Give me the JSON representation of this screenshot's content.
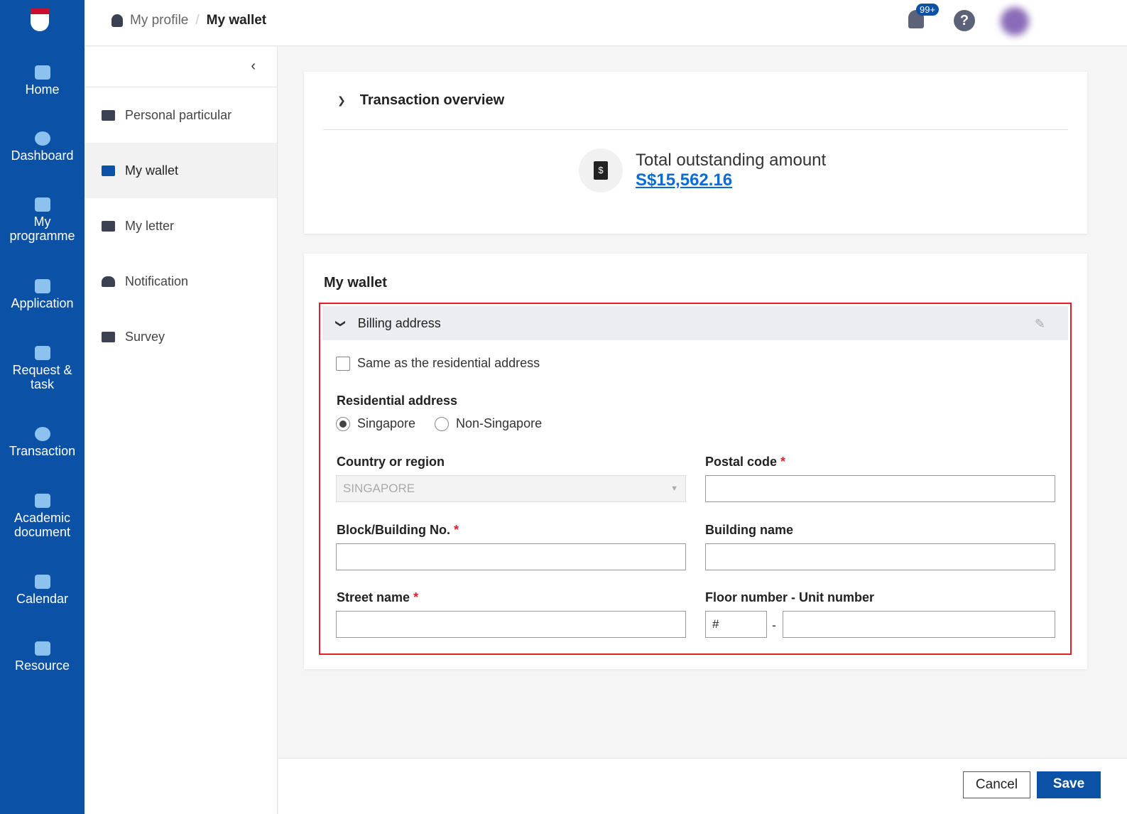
{
  "nav": [
    {
      "label": "Home"
    },
    {
      "label": "Dashboard"
    },
    {
      "label": "My programme"
    },
    {
      "label": "Application"
    },
    {
      "label": "Request & task"
    },
    {
      "label": "Transaction"
    },
    {
      "label": "Academic document"
    },
    {
      "label": "Calendar"
    },
    {
      "label": "Resource"
    }
  ],
  "breadcrumb": {
    "parent": "My profile",
    "sep": "/",
    "current": "My wallet"
  },
  "header": {
    "badge": "99+",
    "help": "?"
  },
  "subnav": {
    "collapse": "‹",
    "items": [
      {
        "label": "Personal particular"
      },
      {
        "label": "My wallet"
      },
      {
        "label": "My letter"
      },
      {
        "label": "Notification"
      },
      {
        "label": "Survey"
      }
    ]
  },
  "overview": {
    "title": "Transaction overview",
    "label": "Total outstanding amount",
    "amount": "S$15,562.16",
    "icon": "$"
  },
  "wallet": {
    "title": "My wallet",
    "section": "Billing address",
    "same": "Same as the residential address",
    "residential": "Residential address",
    "opt1": "Singapore",
    "opt2": "Non-Singapore",
    "country_label": "Country or region",
    "country_value": "SINGAPORE",
    "postal": "Postal code",
    "block": "Block/Building No.",
    "bname": "Building name",
    "street": "Street name",
    "floor": "Floor number - Unit number",
    "floor_prefix": "#",
    "dash": "-",
    "req": "*"
  },
  "footer": {
    "cancel": "Cancel",
    "save": "Save"
  }
}
